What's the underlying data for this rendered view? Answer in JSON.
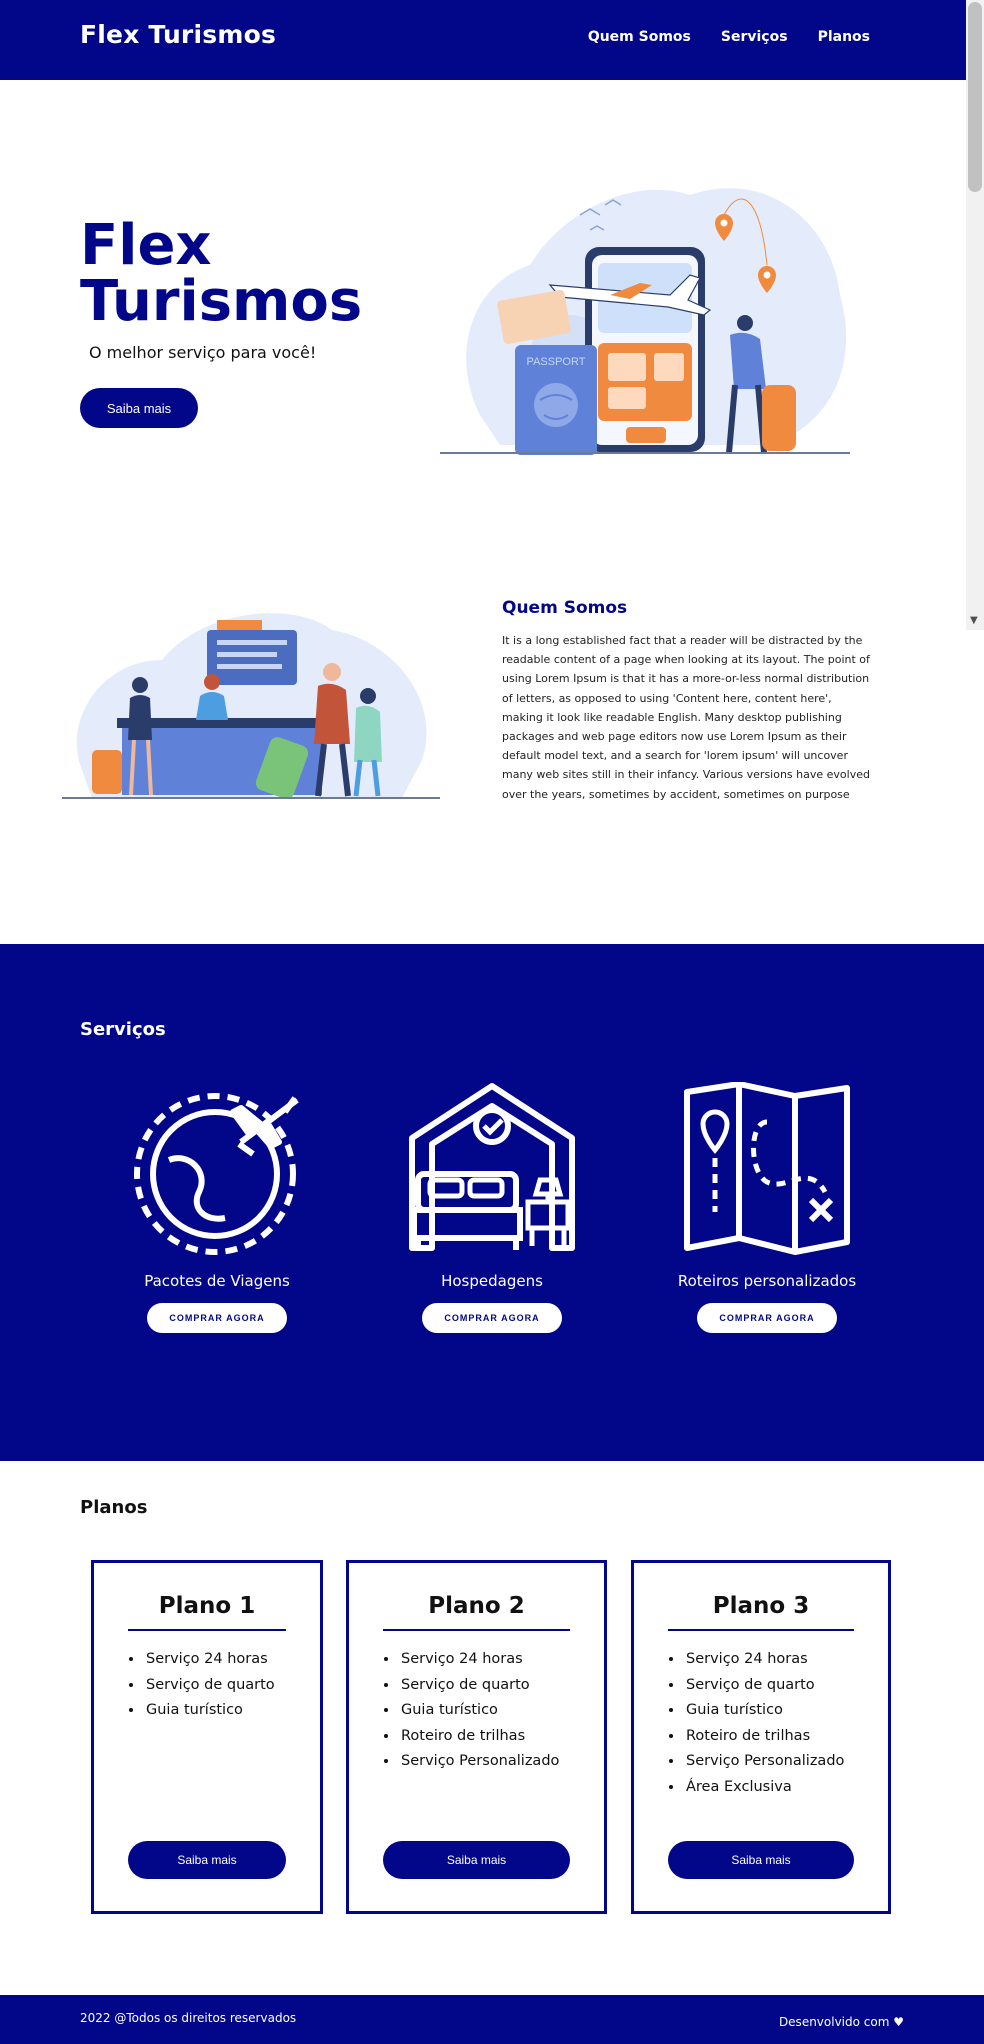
{
  "header": {
    "brand": "Flex Turismos",
    "nav": [
      "Quem Somos",
      "Serviços",
      "Planos"
    ]
  },
  "hero": {
    "title": "Flex Turismos",
    "subtitle": "O melhor serviço para você!",
    "button": "Saiba mais",
    "illustration_passport_text": "PASSPORT"
  },
  "about": {
    "title": "Quem Somos",
    "text": "It is a long established fact that a reader will be distracted by the readable content of a page when looking at its layout. The point of using Lorem Ipsum is that it has a more-or-less normal distribution of letters, as opposed to using 'Content here, content here', making it look like readable English. Many desktop publishing packages and web page editors now use Lorem Ipsum as their default model text, and a search for 'lorem ipsum' will uncover many web sites still in their infancy. Various versions have evolved over the years, sometimes by accident, sometimes on purpose"
  },
  "services": {
    "title": "Serviços",
    "items": [
      {
        "label": "Pacotes de Viagens",
        "button": "COMPRAR AGORA",
        "icon": "globe-plane-icon"
      },
      {
        "label": "Hospedagens",
        "button": "COMPRAR AGORA",
        "icon": "hotel-bed-icon"
      },
      {
        "label": "Roteiros personalizados",
        "button": "COMPRAR AGORA",
        "icon": "map-route-icon"
      }
    ]
  },
  "plans": {
    "title": "Planos",
    "items": [
      {
        "name": "Plano 1",
        "features": [
          "Serviço 24 horas",
          "Serviço de quarto",
          "Guia turístico"
        ],
        "button": "Saiba mais"
      },
      {
        "name": "Plano 2",
        "features": [
          "Serviço 24 horas",
          "Serviço de quarto",
          "Guia turístico",
          "Roteiro de trilhas",
          "Serviço Personalizado"
        ],
        "button": "Saiba mais"
      },
      {
        "name": "Plano 3",
        "features": [
          "Serviço 24 horas",
          "Serviço de quarto",
          "Guia turístico",
          "Roteiro de trilhas",
          "Serviço Personalizado",
          "Área Exclusiva"
        ],
        "button": "Saiba mais"
      }
    ]
  },
  "footer": {
    "left": "2022 @Todos os direitos reservados",
    "right": "Desenvolvido com ♥"
  },
  "colors": {
    "primary": "#020789",
    "white": "#ffffff",
    "text": "#111111"
  }
}
